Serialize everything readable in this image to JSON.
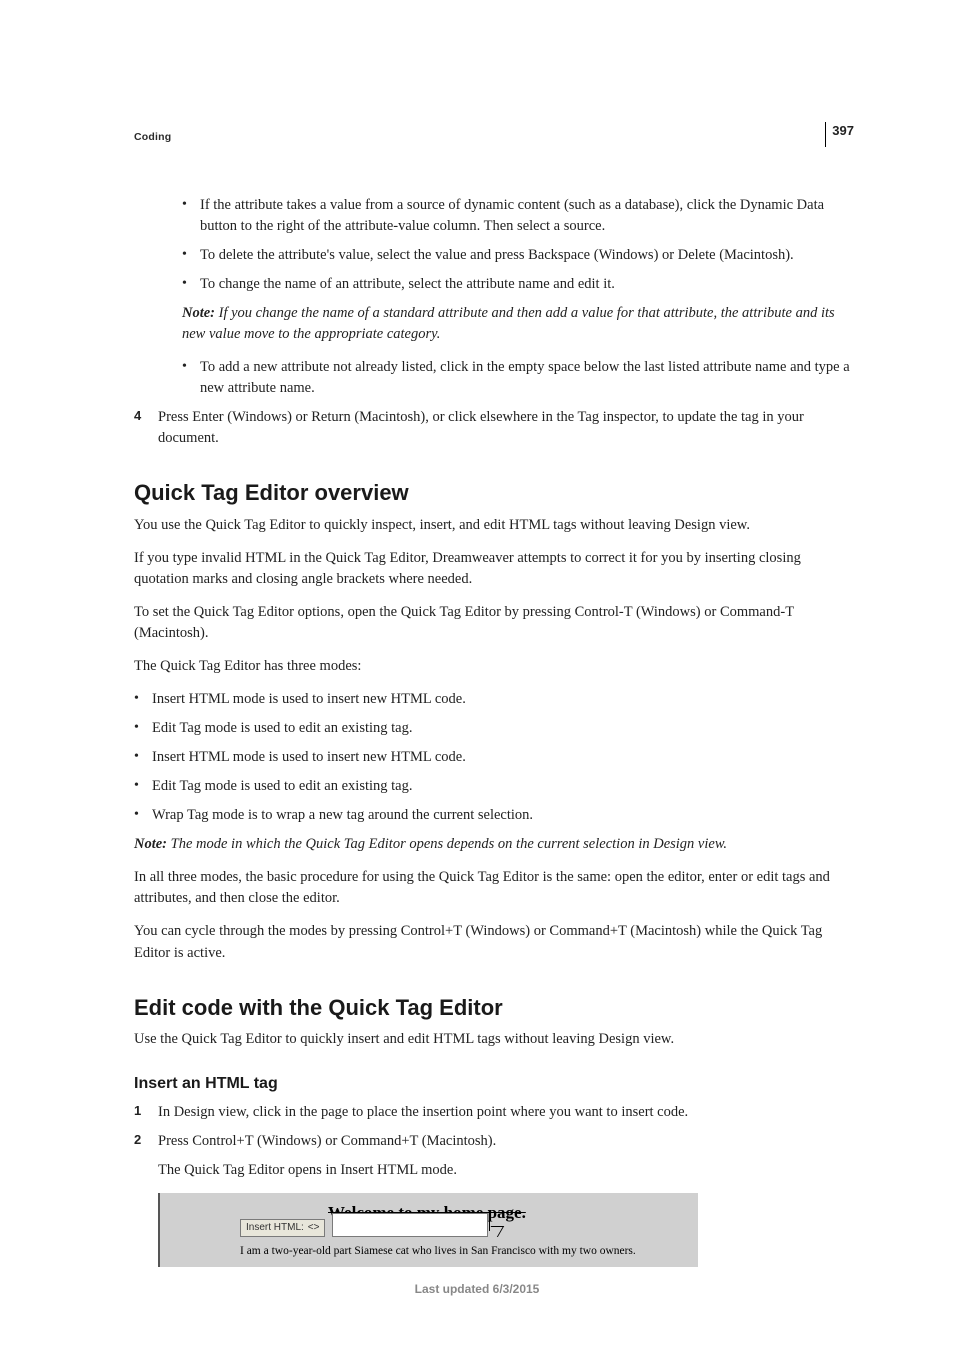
{
  "header": {
    "label": "Coding"
  },
  "page_number": "397",
  "top_bullets": [
    "If the attribute takes a value from a source of dynamic content (such as a database), click the Dynamic Data button to the right of the attribute-value column. Then select a source.",
    "To delete the attribute's value, select the value and press Backspace (Windows) or Delete (Macintosh).",
    "To change the name of an attribute, select the attribute name and edit it."
  ],
  "top_note": {
    "label": "Note:",
    "text": "If you change the name of a standard attribute and then add a value for that attribute, the attribute and its new value move to the appropriate category."
  },
  "top_bullets2": [
    "To add a new attribute not already listed, click in the empty space below the last listed attribute name and type a new attribute name."
  ],
  "step4": {
    "num": "4",
    "text": "Press Enter (Windows) or Return (Macintosh), or click elsewhere in the Tag inspector, to update the tag in your document."
  },
  "sec1": {
    "title": "Quick Tag Editor overview",
    "p1": "You use the Quick Tag Editor to quickly inspect, insert, and edit HTML tags without leaving Design view.",
    "p2": "If you type invalid HTML in the Quick Tag Editor, Dreamweaver attempts to correct it for you by inserting closing quotation marks and closing angle brackets where needed.",
    "p3": "To set the Quick Tag Editor options, open the Quick Tag Editor by pressing Control-T (Windows) or Command-T (Macintosh).",
    "p4": "The Quick Tag Editor has three modes:",
    "modes": [
      "Insert HTML mode is used to insert new HTML code.",
      "Edit Tag mode is used to edit an existing tag.",
      "Insert HTML mode is used to insert new HTML code.",
      "Edit Tag mode is used to edit an existing tag.",
      "Wrap Tag mode is to wrap a new tag around the current selection."
    ],
    "note": {
      "label": "Note:",
      "text": "The mode in which the Quick Tag Editor opens depends on the current selection in Design view."
    },
    "p5": "In all three modes, the basic procedure for using the Quick Tag Editor is the same: open the editor, enter or edit tags and attributes, and then close the editor.",
    "p6": "You can cycle through the modes by pressing Control+T (Windows) or Command+T (Macintosh) while the Quick Tag Editor is active."
  },
  "sec2": {
    "title": "Edit code with the Quick Tag Editor",
    "p1": "Use the Quick Tag Editor to quickly insert and edit HTML tags without leaving Design view.",
    "sub1": {
      "title": "Insert an HTML tag",
      "steps": [
        {
          "num": "1",
          "text": "In Design view, click in the page to place the insertion point where you want to insert code."
        },
        {
          "num": "2",
          "text": "Press Control+T (Windows) or Command+T (Macintosh)."
        }
      ],
      "after": "The Quick Tag Editor opens in Insert HTML mode."
    }
  },
  "figure": {
    "heading_struck": "Welcome to my home pa",
    "heading_tail": "ge.",
    "box_label": "Insert HTML:",
    "box_glyph": "<>",
    "subtext": "I am a two-year-old part Siamese cat who lives in San Francisco with my two owners."
  },
  "footer": "Last updated 6/3/2015"
}
